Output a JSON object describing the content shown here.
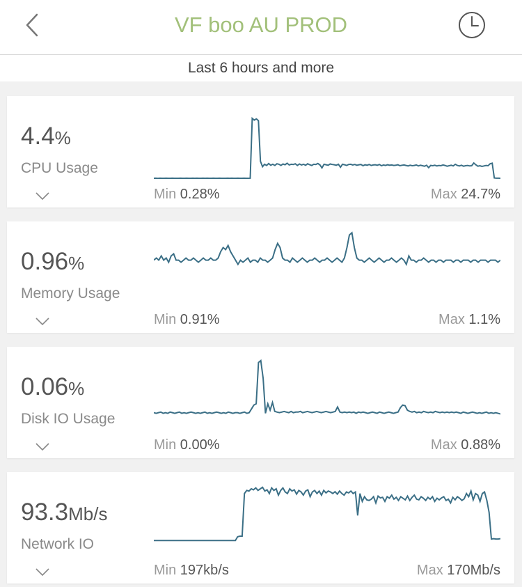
{
  "header": {
    "title": "VF boo AU PROD",
    "back_icon": "chevron-left-icon",
    "history_icon": "clock-icon",
    "title_color": "#a2c07a"
  },
  "timeframe": "Last 6 hours and more",
  "colors": {
    "line": "#3b6f86",
    "label": "#8a8a8a"
  },
  "metrics": [
    {
      "value": "4.4",
      "unit": "%",
      "label": "CPU Usage",
      "min_label": "Min",
      "min_value": "0.28%",
      "max_label": "Max",
      "max_value": "24.7%",
      "series": [
        0.28,
        0.3,
        0.25,
        0.3,
        0.28,
        0.27,
        0.3,
        0.29,
        0.28,
        0.3,
        0.29,
        0.28,
        0.27,
        0.3,
        0.29,
        0.28,
        0.3,
        0.27,
        0.29,
        0.3,
        0.28,
        0.3,
        0.29,
        0.28,
        0.3,
        0.29,
        0.3,
        0.28,
        0.29,
        0.3,
        0.29,
        0.28,
        0.3,
        0.29,
        0.29,
        0.28,
        0.3,
        0.29,
        0.3,
        0.28,
        0.29,
        0.3,
        0.28,
        0.29,
        0.3,
        0.28,
        0.29,
        0.3,
        24.7,
        24.0,
        24.5,
        23.8,
        7.2,
        5.0,
        6.0,
        5.5,
        6.3,
        5.6,
        6.0,
        5.5,
        6.2,
        6.0,
        5.5,
        6.1,
        5.8,
        6.4,
        5.7,
        6.0,
        5.9,
        6.2,
        5.5,
        6.1,
        5.7,
        6.0,
        5.6,
        6.2,
        5.8,
        5.5,
        6.0,
        5.9,
        6.3,
        5.7,
        4.5,
        6.0,
        5.8,
        5.6,
        6.1,
        5.9,
        5.8,
        5.6,
        6.0,
        4.8,
        6.0,
        5.8,
        5.5,
        5.9,
        6.0,
        5.7,
        5.9,
        5.6,
        5.8,
        5.9,
        5.4,
        5.8,
        5.6,
        5.9,
        5.5,
        5.7,
        5.8,
        5.6,
        5.9,
        5.4,
        5.7,
        5.5,
        5.8,
        5.6,
        5.7,
        5.5,
        5.6,
        5.8,
        5.4,
        5.6,
        5.7,
        5.5,
        5.3,
        5.6,
        5.4,
        5.5,
        5.7,
        5.3,
        5.6,
        5.4,
        5.2,
        5.6,
        4.6,
        5.5,
        5.4,
        5.6,
        5.3,
        5.5,
        5.4,
        5.7,
        5.5,
        5.2,
        5.4,
        5.6,
        5.3,
        6.0,
        5.5,
        5.3,
        5.6,
        5.2,
        5.4,
        5.5,
        5.3,
        5.4,
        6.5,
        5.8,
        5.2,
        5.4,
        5.1,
        5.3,
        5.5,
        5.4,
        6.2,
        6.4,
        0.4,
        0.3,
        0.3,
        0.28
      ],
      "ylim": [
        0.28,
        24.7
      ]
    },
    {
      "value": "0.96",
      "unit": "%",
      "label": "Memory Usage",
      "min_label": "Min",
      "min_value": "0.91%",
      "max_label": "Max",
      "max_value": "1.1%",
      "series": [
        0.96,
        0.97,
        0.96,
        0.98,
        0.96,
        0.97,
        0.95,
        0.98,
        0.99,
        0.96,
        0.96,
        0.95,
        0.96,
        0.97,
        0.96,
        0.96,
        0.97,
        0.96,
        0.95,
        0.96,
        0.97,
        0.96,
        0.96,
        0.97,
        0.96,
        0.96,
        0.97,
        1.0,
        1.02,
        1.01,
        1.03,
        1.0,
        0.98,
        0.96,
        0.94,
        0.96,
        0.95,
        0.96,
        0.97,
        0.95,
        0.96,
        0.96,
        0.95,
        0.97,
        0.96,
        0.96,
        0.95,
        0.96,
        0.97,
        1.01,
        1.04,
        1.02,
        0.97,
        0.96,
        0.96,
        0.95,
        0.97,
        0.96,
        0.95,
        0.96,
        0.97,
        0.96,
        0.95,
        0.96,
        0.96,
        0.97,
        0.96,
        0.95,
        0.96,
        0.96,
        0.97,
        0.96,
        0.95,
        0.96,
        0.97,
        0.96,
        0.95,
        0.97,
        1.02,
        1.08,
        1.09,
        1.02,
        0.97,
        0.96,
        0.96,
        0.95,
        0.96,
        0.97,
        0.96,
        0.95,
        0.96,
        0.97,
        0.96,
        0.95,
        0.96,
        0.96,
        0.97,
        0.96,
        0.95,
        0.96,
        0.97,
        0.96,
        0.94,
        0.98,
        0.96,
        0.96,
        0.95,
        0.96,
        0.96,
        0.97,
        0.96,
        0.95,
        0.96,
        0.96,
        0.95,
        0.96,
        0.96,
        0.95,
        0.96,
        0.96,
        0.96,
        0.95,
        0.96,
        0.96,
        0.95,
        0.96,
        0.96,
        0.96,
        0.95,
        0.96,
        0.96,
        0.95,
        0.96,
        0.96,
        0.96,
        0.95,
        0.96,
        0.96,
        0.96,
        0.95,
        0.96
      ],
      "ylim": [
        0.91,
        1.1
      ]
    },
    {
      "value": "0.06",
      "unit": "%",
      "label": "Disk IO Usage",
      "min_label": "Min",
      "min_value": "0.00%",
      "max_label": "Max",
      "max_value": "0.88%",
      "series": [
        0.06,
        0.05,
        0.06,
        0.07,
        0.05,
        0.06,
        0.05,
        0.07,
        0.06,
        0.05,
        0.06,
        0.07,
        0.05,
        0.06,
        0.05,
        0.06,
        0.07,
        0.06,
        0.05,
        0.06,
        0.05,
        0.06,
        0.07,
        0.05,
        0.06,
        0.05,
        0.06,
        0.07,
        0.06,
        0.05,
        0.06,
        0.05,
        0.07,
        0.06,
        0.05,
        0.06,
        0.06,
        0.05,
        0.06,
        0.07,
        0.05,
        0.06,
        0.12,
        0.18,
        0.2,
        0.85,
        0.88,
        0.6,
        0.05,
        0.2,
        0.1,
        0.22,
        0.08,
        0.07,
        0.06,
        0.07,
        0.08,
        0.07,
        0.06,
        0.08,
        0.06,
        0.07,
        0.07,
        0.08,
        0.06,
        0.07,
        0.08,
        0.07,
        0.06,
        0.07,
        0.08,
        0.07,
        0.06,
        0.07,
        0.08,
        0.07,
        0.06,
        0.07,
        0.08,
        0.15,
        0.07,
        0.06,
        0.07,
        0.06,
        0.07,
        0.06,
        0.07,
        0.05,
        0.07,
        0.06,
        0.07,
        0.06,
        0.05,
        0.06,
        0.07,
        0.06,
        0.05,
        0.07,
        0.06,
        0.05,
        0.06,
        0.07,
        0.06,
        0.05,
        0.06,
        0.07,
        0.14,
        0.18,
        0.17,
        0.1,
        0.08,
        0.07,
        0.08,
        0.06,
        0.07,
        0.06,
        0.08,
        0.07,
        0.06,
        0.07,
        0.06,
        0.08,
        0.07,
        0.06,
        0.07,
        0.06,
        0.07,
        0.06,
        0.07,
        0.06,
        0.07,
        0.06,
        0.05,
        0.07,
        0.06,
        0.05,
        0.06,
        0.07,
        0.06,
        0.05,
        0.06,
        0.05,
        0.06,
        0.07,
        0.05,
        0.06,
        0.05,
        0.06,
        0.05,
        0.04
      ],
      "ylim": [
        0.0,
        0.88
      ]
    },
    {
      "value": "93.3",
      "unit": "Mb/s",
      "label": "Network IO",
      "min_label": "Min",
      "min_value": "197kb/s",
      "max_label": "Max",
      "max_value": "170Mb/s",
      "series": [
        0.2,
        0.2,
        0.2,
        0.2,
        0.2,
        0.2,
        0.2,
        0.2,
        0.2,
        0.2,
        0.2,
        0.2,
        0.2,
        0.2,
        0.2,
        0.2,
        0.2,
        0.2,
        0.2,
        0.2,
        0.2,
        0.2,
        0.2,
        0.2,
        0.2,
        0.2,
        0.2,
        0.2,
        0.2,
        0.2,
        0.2,
        0.2,
        0.2,
        0.2,
        0.2,
        0.2,
        0.2,
        12,
        14,
        14,
        150,
        160,
        158,
        165,
        162,
        168,
        160,
        165,
        170,
        158,
        162,
        150,
        168,
        160,
        165,
        145,
        160,
        168,
        155,
        150,
        165,
        158,
        162,
        148,
        160,
        155,
        145,
        158,
        162,
        140,
        155,
        160,
        150,
        158,
        145,
        160,
        152,
        158,
        155,
        150,
        156,
        148,
        158,
        150,
        145,
        155,
        152,
        158,
        150,
        155,
        80,
        150,
        125,
        140,
        130,
        128,
        132,
        140,
        120,
        142,
        136,
        138,
        125,
        140,
        135,
        145,
        132,
        138,
        128,
        140,
        135,
        130,
        142,
        128,
        138,
        145,
        132,
        130,
        140,
        135,
        128,
        138,
        132,
        140,
        125,
        135,
        130,
        136,
        140,
        128,
        132,
        120,
        138,
        130,
        140,
        135,
        128,
        133,
        150,
        140,
        158,
        130,
        150,
        145,
        125,
        150,
        155,
        128,
        90,
        5,
        6,
        5,
        5,
        6
      ],
      "ylim": [
        0.2,
        170
      ]
    }
  ]
}
